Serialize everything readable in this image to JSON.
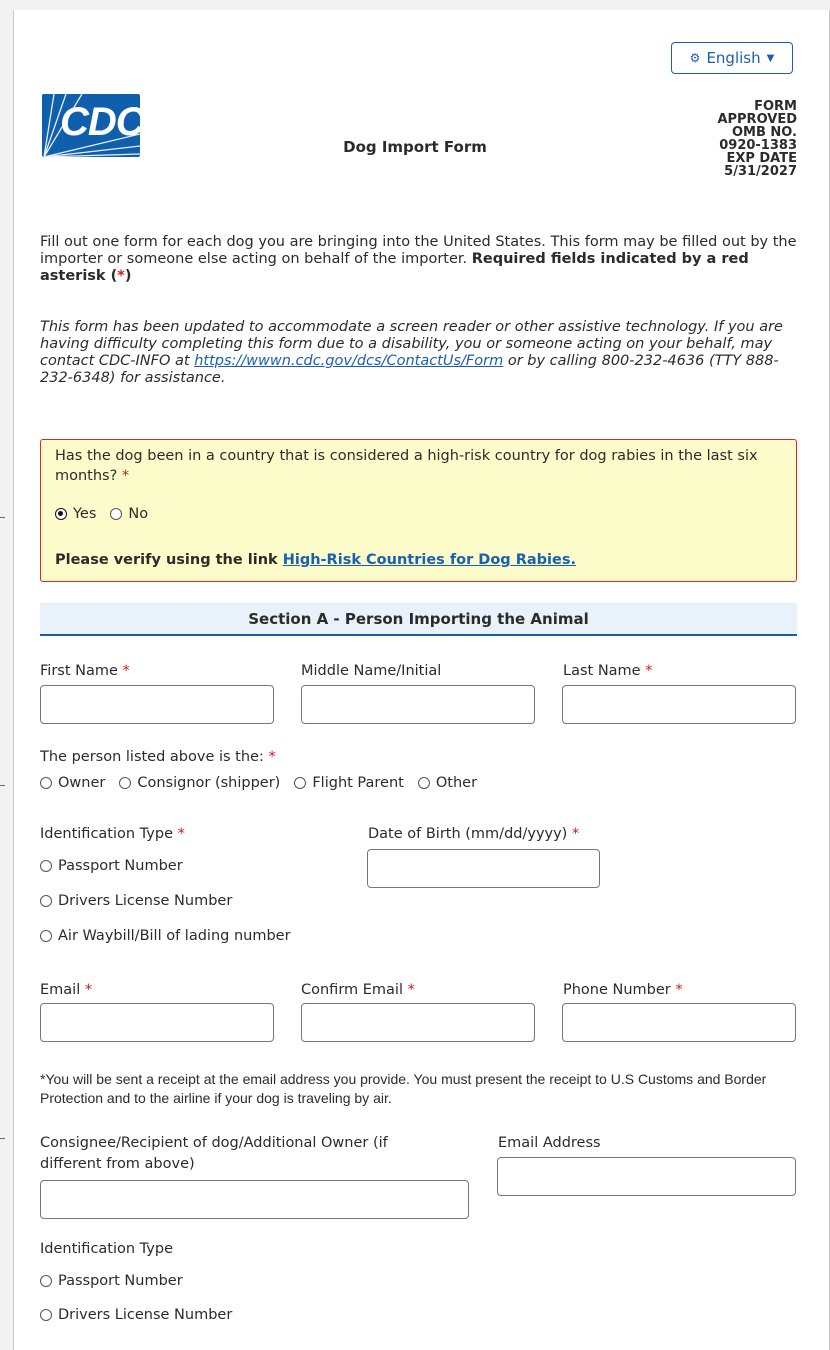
{
  "header": {
    "language_button": "English",
    "title": "Dog Import Form",
    "form_meta": [
      "FORM",
      "APPROVED",
      "OMB NO.",
      "0920-1383",
      "EXP DATE",
      "5/31/2027"
    ],
    "logo_text": "CDC"
  },
  "intro": {
    "text": "Fill out one form for each dog you are bringing into the United States. This form may be filled out by the importer or someone else acting on behalf of the importer.",
    "required_note_prefix": "Required fields indicated by a red asterisk (",
    "asterisk": "*",
    "required_note_suffix": ")"
  },
  "accessibility_note": {
    "text_before": "This form has been updated to accommodate a screen reader or other assistive technology. If you are having difficulty completing this form due to a disability, you or someone acting on your behalf, may contact CDC-INFO at ",
    "link": "https://wwwn.cdc.gov/dcs/ContactUs/Form",
    "text_after": " or by calling 800-232-4636 (TTY 888-232-6348) for assistance."
  },
  "rabies_question": {
    "question": "Has the dog been in a country that is considered a high-risk country for dog rabies in the last six months?",
    "options": [
      "Yes",
      "No"
    ],
    "selected": "Yes",
    "verify_prefix": "Please verify using the link",
    "verify_link": "High-Risk Countries for Dog Rabies."
  },
  "section_a": {
    "title": "Section A - Person Importing the Animal",
    "first_name": "First Name",
    "middle_name": "Middle Name/Initial",
    "last_name": "Last Name",
    "person_is": "The person listed above is  the:",
    "person_options": [
      "Owner",
      "Consignor (shipper)",
      "Flight Parent",
      "Other"
    ],
    "id_type": "Identification Type",
    "id_options": [
      "Passport Number",
      "Drivers License Number",
      "Air Waybill/Bill of lading number"
    ],
    "dob": "Date of Birth (mm/dd/yyyy)",
    "email": "Email",
    "confirm_email": "Confirm Email",
    "phone": "Phone Number",
    "receipt_note": "*You will be sent a receipt at the email address you provide. You must present the receipt to U.S Customs and Border Protection and to the airline if your dog is traveling by air.",
    "consignee": "Consignee/Recipient of dog/Additional Owner (if different from above)",
    "email_address": "Email Address",
    "id_type_2": "Identification Type",
    "id_options_2": [
      "Passport Number",
      "Drivers License Number"
    ]
  },
  "colors": {
    "accent": "#0f5fac",
    "required": "#cc1a1a",
    "alert_bg": "#fcfccb",
    "alert_border": "#d62a2a"
  }
}
